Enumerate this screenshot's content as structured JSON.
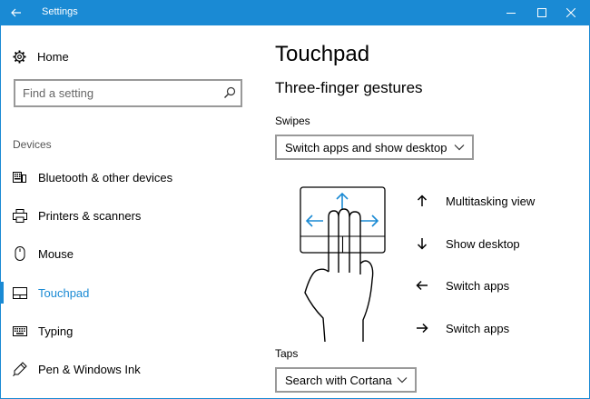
{
  "window": {
    "title": "Settings"
  },
  "sidebar": {
    "home_label": "Home",
    "search_placeholder": "Find a setting",
    "section_label": "Devices",
    "items": [
      {
        "label": "Bluetooth & other devices",
        "icon": "bluetooth-devices-icon"
      },
      {
        "label": "Printers & scanners",
        "icon": "printer-icon"
      },
      {
        "label": "Mouse",
        "icon": "mouse-icon"
      },
      {
        "label": "Touchpad",
        "icon": "touchpad-icon",
        "active": true
      },
      {
        "label": "Typing",
        "icon": "keyboard-icon"
      },
      {
        "label": "Pen & Windows Ink",
        "icon": "pen-icon"
      }
    ]
  },
  "main": {
    "title": "Touchpad",
    "subtitle": "Three-finger gestures",
    "swipes": {
      "label": "Swipes",
      "value": "Switch apps and show desktop"
    },
    "gestures": [
      {
        "direction": "up",
        "label": "Multitasking view"
      },
      {
        "direction": "down",
        "label": "Show desktop"
      },
      {
        "direction": "left",
        "label": "Switch apps"
      },
      {
        "direction": "right",
        "label": "Switch apps"
      }
    ],
    "taps": {
      "label": "Taps",
      "value": "Search with Cortana"
    }
  },
  "colors": {
    "accent": "#1a8ad4",
    "border": "#999999",
    "text": "#000000",
    "section": "#555555"
  }
}
